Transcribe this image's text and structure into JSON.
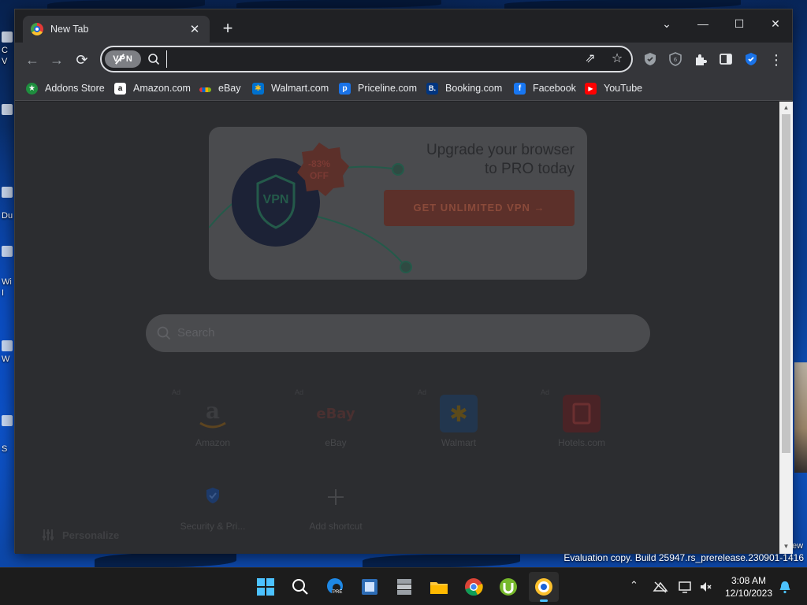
{
  "desktop": {
    "left_labels": [
      "C",
      "V",
      "Du",
      "Wi",
      "I",
      "W",
      "S"
    ],
    "right_label": "ew",
    "evaluation_text": "Evaluation copy. Build 25947.rs_prerelease.230901-1416"
  },
  "browser": {
    "tab": {
      "title": "New Tab",
      "close": "✕",
      "favicon": "browser-logo-icon"
    },
    "new_tab": "+",
    "window_controls": {
      "dropdown": "⌄",
      "minimize": "—",
      "maximize": "☐",
      "close": "✕"
    },
    "nav": {
      "back": "←",
      "forward": "→",
      "reload": "⟳"
    },
    "omnibox": {
      "vpn_label": "VPN",
      "value": "",
      "placeholder": ""
    },
    "bookmarks": [
      {
        "label": "Addons Store",
        "icon": "addons-store-icon",
        "color": "#1e8e3e",
        "glyph": "★"
      },
      {
        "label": "Amazon.com",
        "icon": "amazon-icon",
        "color": "#ffffff",
        "glyph": "a"
      },
      {
        "label": "eBay",
        "icon": "ebay-icon",
        "color": "#e53238",
        "glyph": "▬"
      },
      {
        "label": "Walmart.com",
        "icon": "walmart-icon",
        "color": "#0071ce",
        "glyph": "✱"
      },
      {
        "label": "Priceline.com",
        "icon": "priceline-icon",
        "color": "#1a73e8",
        "glyph": "p"
      },
      {
        "label": "Booking.com",
        "icon": "booking-icon",
        "color": "#003580",
        "glyph": "B."
      },
      {
        "label": "Facebook",
        "icon": "facebook-icon",
        "color": "#1877f2",
        "glyph": "f"
      },
      {
        "label": "YouTube",
        "icon": "youtube-icon",
        "color": "#ff0000",
        "glyph": "▶"
      }
    ]
  },
  "ntp": {
    "promo": {
      "title_line1": "Upgrade your browser",
      "title_line2": "to PRO today",
      "badge_percent": "-83%",
      "badge_off": "OFF",
      "vpn_label": "VPN",
      "cta": "GET UNLIMITED VPN →"
    },
    "search_placeholder": "Search",
    "shortcuts": [
      {
        "label": "Amazon",
        "ad": "Ad",
        "icon": "amazon-shortcut-icon"
      },
      {
        "label": "eBay",
        "ad": "Ad",
        "icon": "ebay-shortcut-icon"
      },
      {
        "label": "Walmart",
        "ad": "Ad",
        "icon": "walmart-shortcut-icon"
      },
      {
        "label": "Hotels.com",
        "ad": "Ad",
        "icon": "hotels-shortcut-icon"
      },
      {
        "label": "Security & Pri...",
        "icon": "security-shortcut-icon"
      },
      {
        "label": "Add shortcut",
        "icon": "add-shortcut-icon"
      }
    ],
    "personalize": "Personalize"
  },
  "taskbar": {
    "clock_time": "3:08 AM",
    "clock_date": "12/10/2023",
    "edge_badge": "PRE"
  }
}
